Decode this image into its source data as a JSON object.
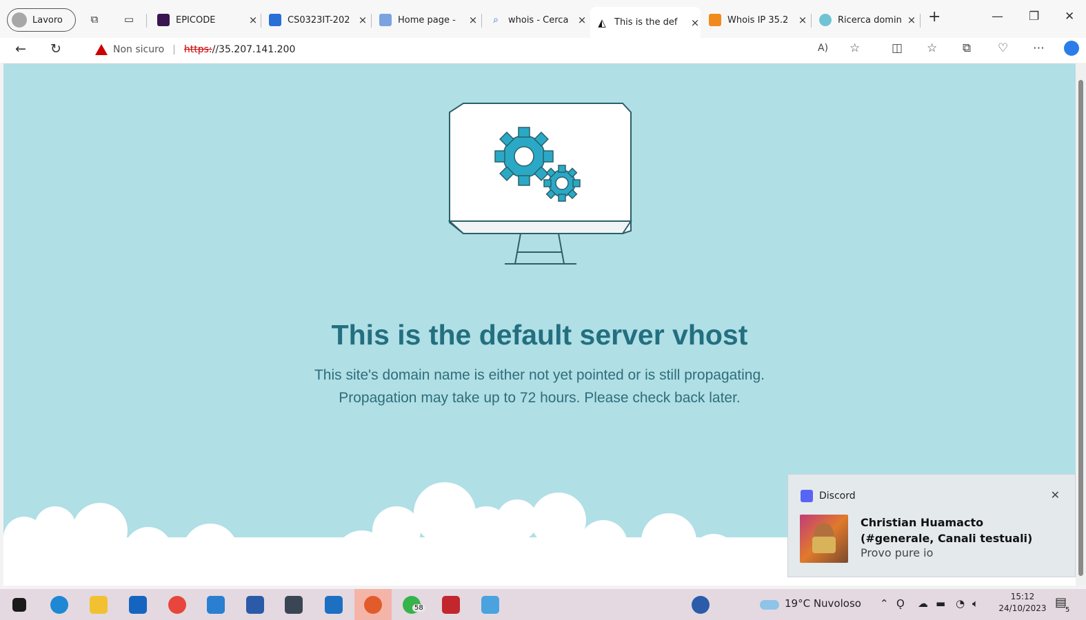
{
  "browser": {
    "profile_label": "Lavoro",
    "tabs": [
      {
        "title": "EPICODE",
        "fav_color": "#3a1550"
      },
      {
        "title": "CS0323IT-202",
        "fav_color": "#2b6fd6"
      },
      {
        "title": "Home page -",
        "fav_color": "#7aa3e0"
      },
      {
        "title": "whois - Cerca",
        "fav_color": "#ffffff"
      },
      {
        "title": "This is the def",
        "fav_color": "#ffffff"
      },
      {
        "title": "Whois IP 35.2",
        "fav_color": "#f08a1c"
      },
      {
        "title": "Ricerca domin",
        "fav_color": "#6fc4d3"
      }
    ],
    "new_tab": "+",
    "security_label": "Non sicuro",
    "url_scheme": "https:",
    "url_rest": "//35.207.141.200"
  },
  "page": {
    "heading": "This is the default server vhost",
    "line1": "This site's domain name is either not yet pointed or is still propagating.",
    "line2": "Propagation may take up to 72 hours. Please check back later.",
    "bg_color": "#b0dfe6",
    "accent_color": "#2aa9c6"
  },
  "notification": {
    "app": "Discord",
    "title": "Christian Huamacto (#generale, Canali testuali)",
    "body": "Provo pure io"
  },
  "taskbar": {
    "whatsapp_badge": "58",
    "weather": "19°C  Nuvoloso",
    "time": "15:12",
    "date": "24/10/2023",
    "notif_count": "5"
  }
}
